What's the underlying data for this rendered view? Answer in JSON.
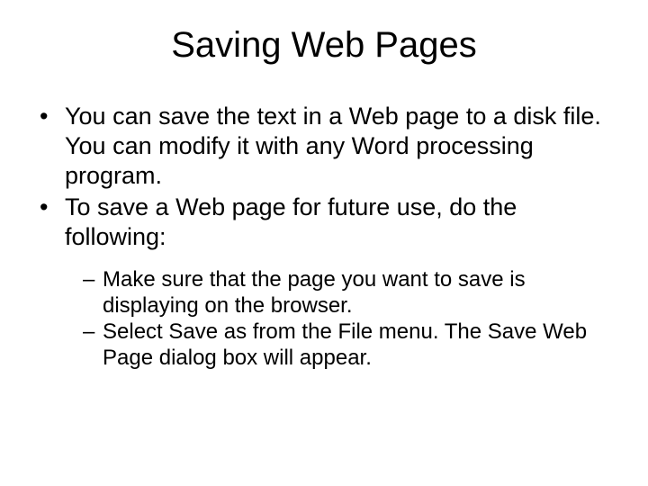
{
  "title": "Saving Web Pages",
  "bullets": [
    "You can save the text in a Web page to a disk file. You can modify it with any Word processing program.",
    "To save a Web page for future use, do the following:"
  ],
  "subbullets": [
    "Make sure that the page you want to save is displaying on the browser.",
    "Select Save as from the File menu. The Save Web Page dialog box will appear."
  ]
}
